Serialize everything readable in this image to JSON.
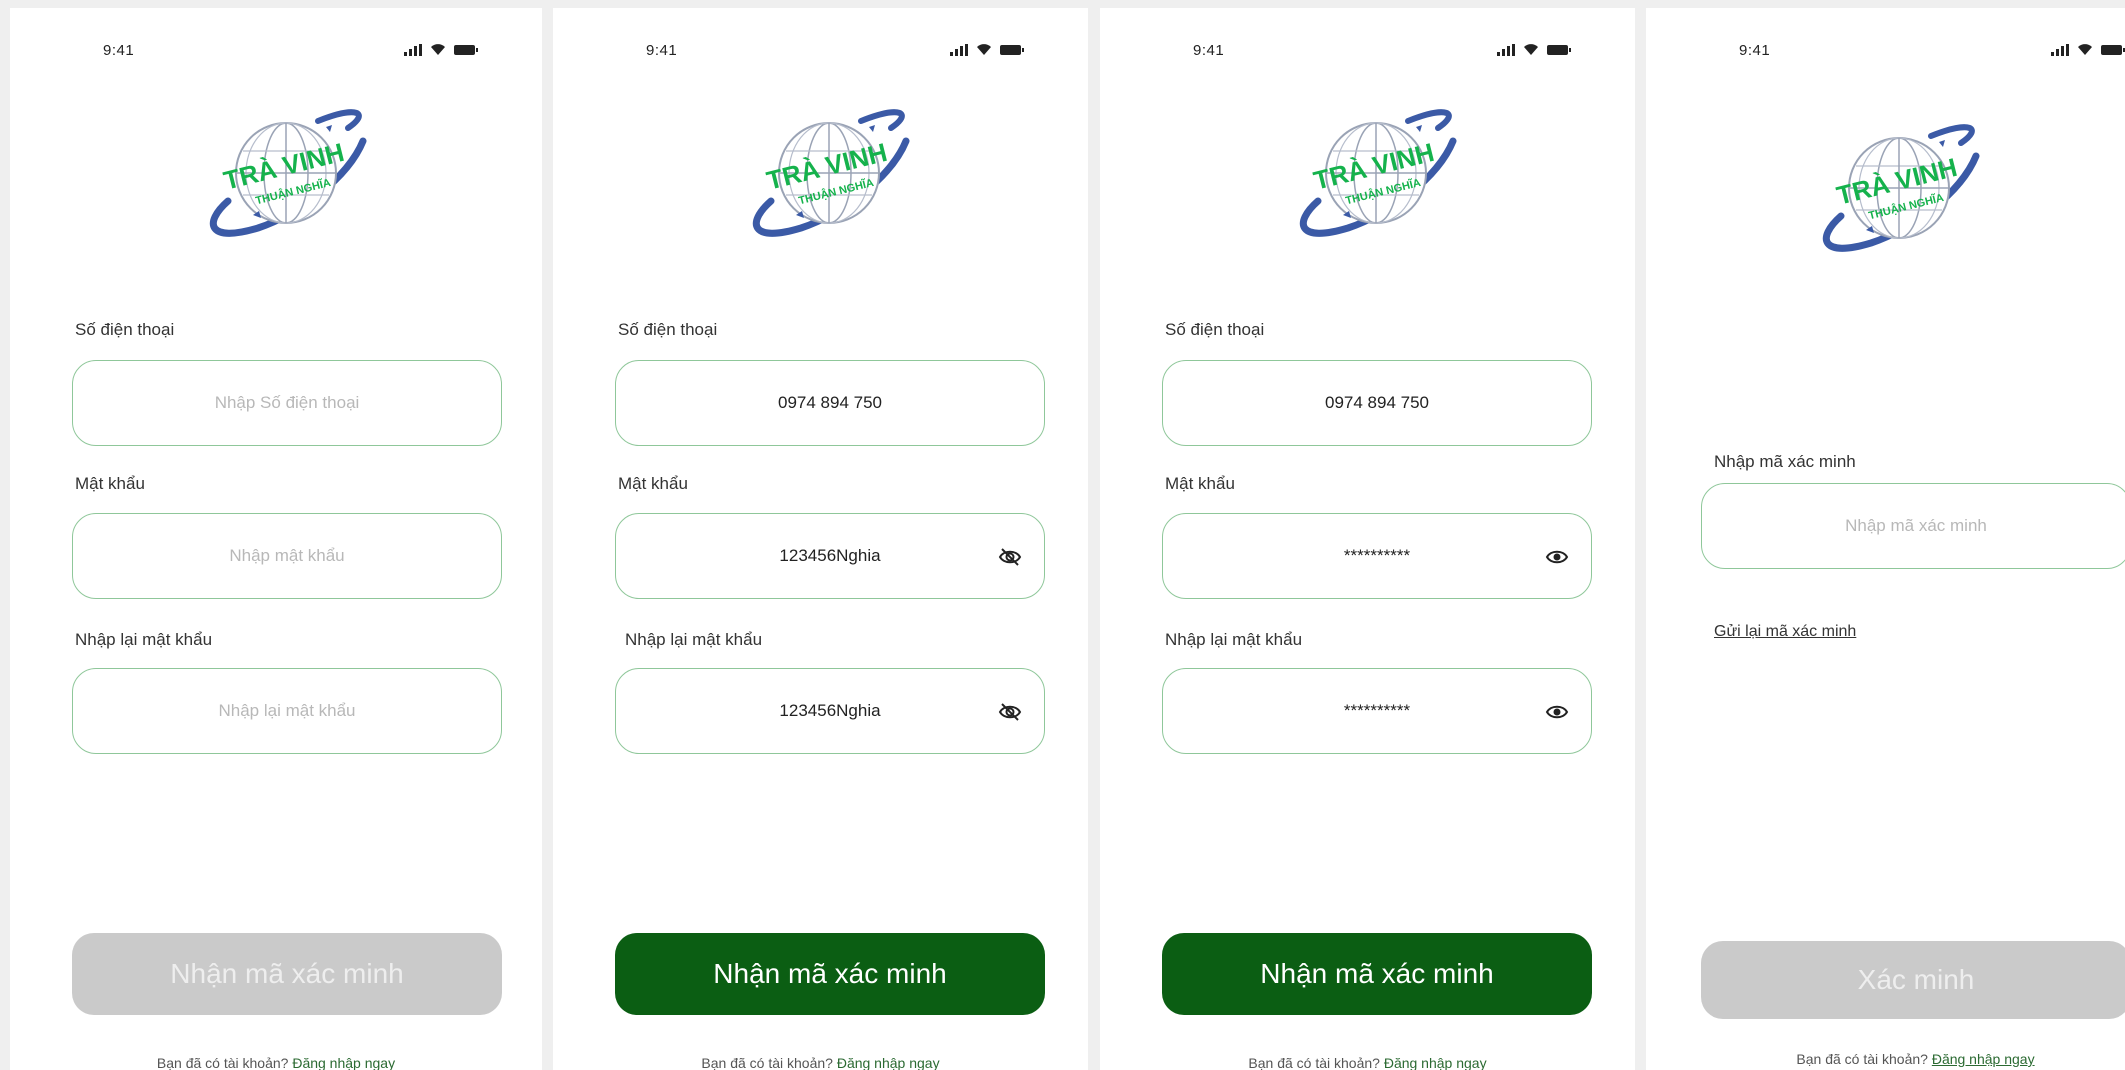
{
  "colors": {
    "accent_green": "#0b5e13",
    "field_border": "#8fc79a",
    "disabled_button": "#cacaca",
    "logo_text_green": "#15b24c",
    "logo_swoosh_blue": "#3b5aa6"
  },
  "status_bar": {
    "time": "9:41",
    "icons": [
      "signal-icon",
      "wifi-icon",
      "battery-icon"
    ]
  },
  "logo": {
    "text_main": "TRÀ VINH",
    "text_sub": "THUẬN NGHĨA"
  },
  "screens": [
    {
      "phone_label": "Số điện thoại",
      "phone_value": "",
      "phone_placeholder": "Nhập Số điện thoại",
      "password_label": "Mật khẩu",
      "password_value": "",
      "password_placeholder": "Nhập mật khẩu",
      "confirm_label": "Nhập lại mật khẩu",
      "confirm_value": "",
      "confirm_placeholder": "Nhập lại mật khẩu",
      "button_label": "Nhận mã xác minh",
      "button_state": "disabled",
      "footer_text": "Bạn đã có tài khoản?",
      "footer_link": "Đăng nhập ngay"
    },
    {
      "phone_label": "Số điện thoại",
      "phone_value": "0974 894 750",
      "password_label": "Mật khẩu",
      "password_value": "123456Nghia",
      "confirm_label": "Nhập lại mật khẩu",
      "confirm_value": "123456Nghia",
      "button_label": "Nhận mã xác minh",
      "button_state": "active",
      "footer_text": "Bạn đã có tài khoản?",
      "footer_link": "Đăng nhập ngay"
    },
    {
      "phone_label": "Số điện thoại",
      "phone_value": "0974 894 750",
      "password_label": "Mật khẩu",
      "password_value": "**********",
      "confirm_label": "Nhập lại mật khẩu",
      "confirm_value": "**********",
      "button_label": "Nhận mã xác minh",
      "button_state": "active",
      "footer_text": "Bạn đã có tài khoản?",
      "footer_link": "Đăng nhập ngay"
    },
    {
      "code_label": "Nhập mã xác minh",
      "code_value": "",
      "code_placeholder": "Nhập mã xác minh",
      "resend_link": "Gửi lại mã xác minh",
      "button_label": "Xác minh",
      "button_state": "disabled",
      "footer_text": "Bạn đã có tài khoản?",
      "footer_link": "Đăng nhập ngay"
    }
  ]
}
